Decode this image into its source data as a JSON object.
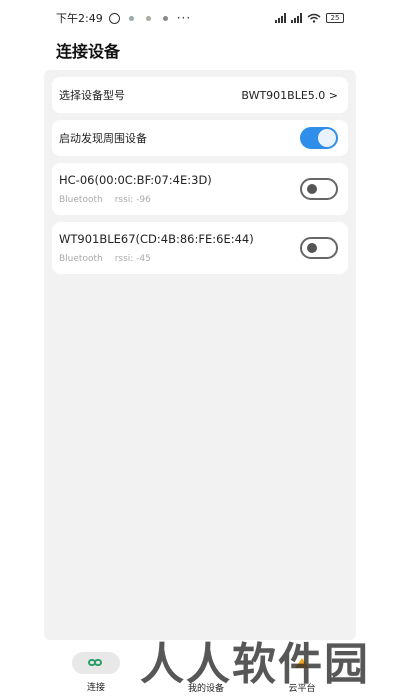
{
  "status_bar": {
    "time": "下午2:49",
    "battery": "25"
  },
  "header": {
    "title": "连接设备"
  },
  "model_row": {
    "label": "选择设备型号",
    "value": "BWT901BLE5.0 >"
  },
  "discover_row": {
    "label": "启动发现周围设备",
    "enabled": true
  },
  "devices": [
    {
      "name": "HC-06(00:0C:BF:07:4E:3D)",
      "type": "Bluetooth",
      "rssi": "rssi: -96",
      "connected": false
    },
    {
      "name": "WT901BLE67(CD:4B:86:FE:6E:44)",
      "type": "Bluetooth",
      "rssi": "rssi: -45",
      "connected": false
    }
  ],
  "bottom_nav": [
    {
      "label": "连接",
      "active": true,
      "icon": "link-icon"
    },
    {
      "label": "我的设备",
      "active": false,
      "icon": ""
    },
    {
      "label": "云平台",
      "active": false,
      "icon": "cloud-icon"
    }
  ],
  "watermark": "人人软件园",
  "colors": {
    "accent": "#2f8eea",
    "nav_active": "#2e9f6a",
    "panel_bg": "#f2f2f2"
  }
}
